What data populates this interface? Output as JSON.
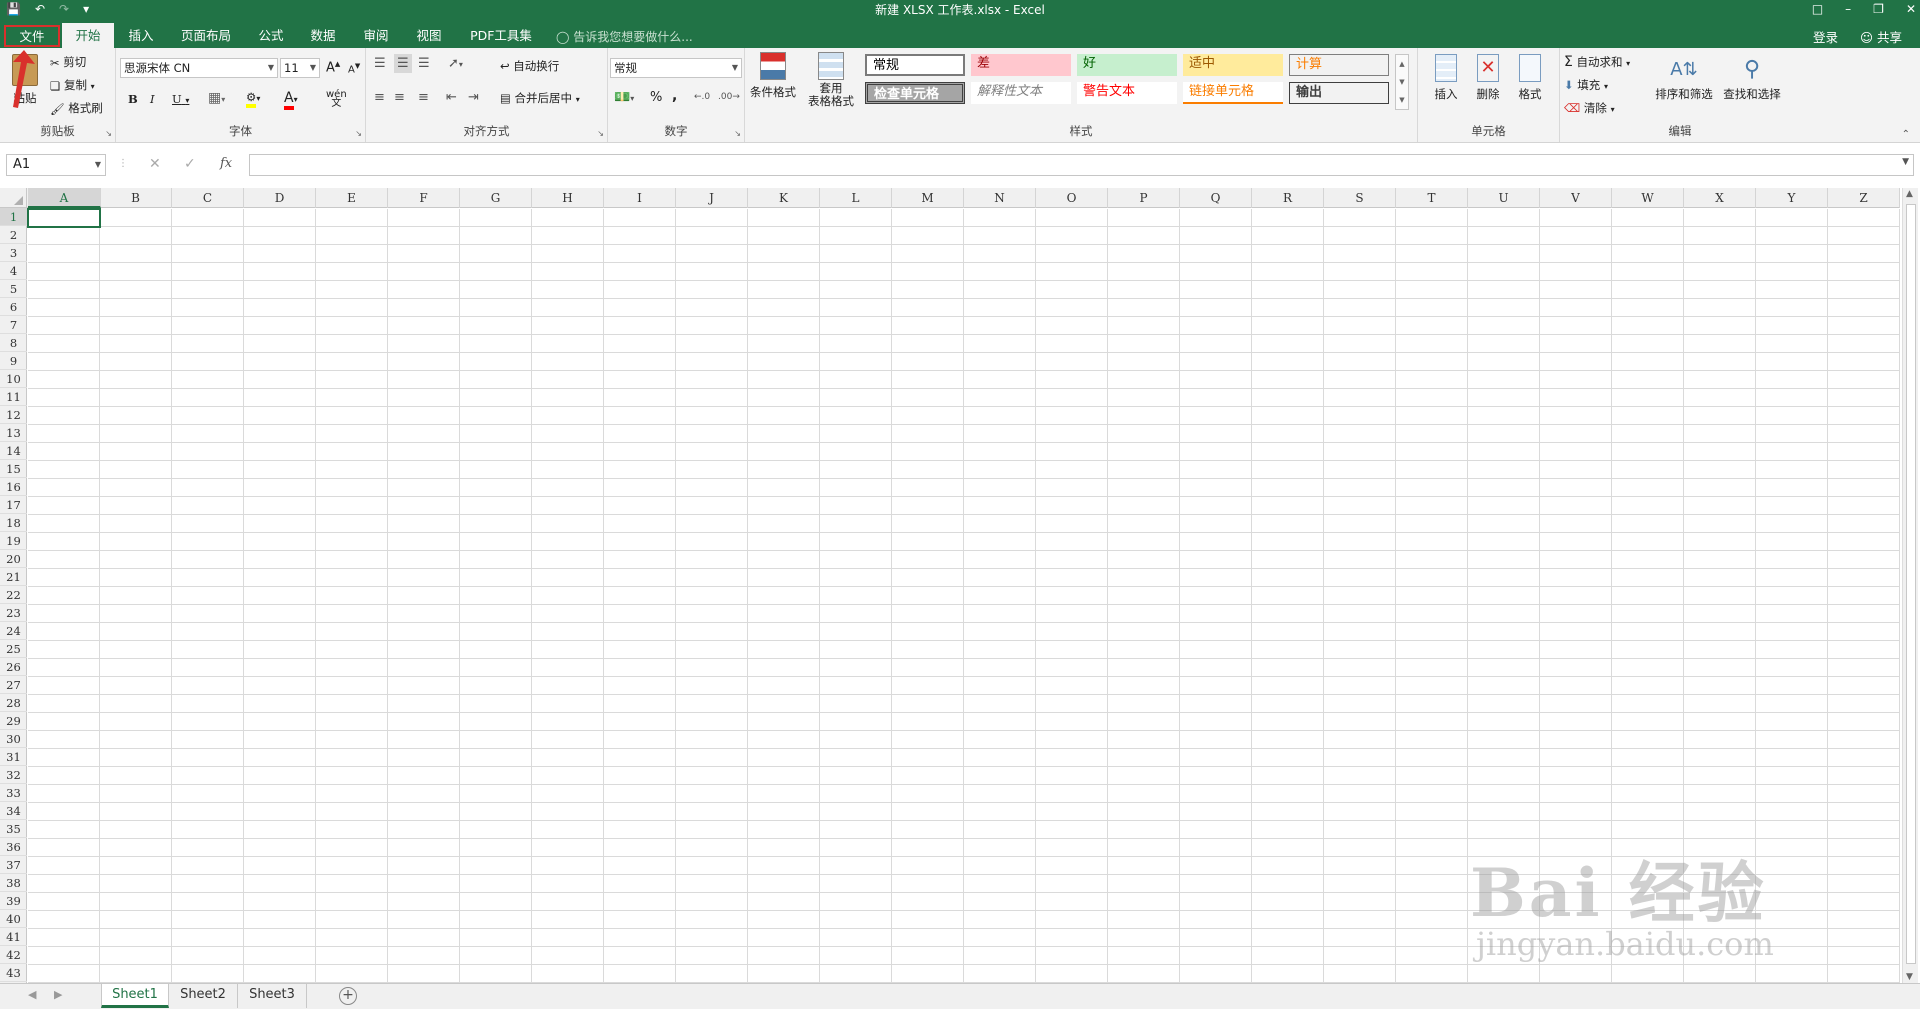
{
  "window": {
    "title": "新建 XLSX 工作表.xlsx - Excel"
  },
  "tabs": [
    {
      "id": "file",
      "label": "文件"
    },
    {
      "id": "home",
      "label": "开始"
    },
    {
      "id": "insert",
      "label": "插入"
    },
    {
      "id": "layout",
      "label": "页面布局"
    },
    {
      "id": "formulas",
      "label": "公式"
    },
    {
      "id": "data",
      "label": "数据"
    },
    {
      "id": "review",
      "label": "审阅"
    },
    {
      "id": "view",
      "label": "视图"
    },
    {
      "id": "pdf",
      "label": "PDF工具集"
    }
  ],
  "tell_me": "告诉我您想要做什么...",
  "account": {
    "login": "登录",
    "share": "共享"
  },
  "ribbon": {
    "clipboard": {
      "label": "剪贴板",
      "paste": "粘贴",
      "cut": "剪切",
      "copy": "复制",
      "format_painter": "格式刷"
    },
    "font": {
      "label": "字体",
      "name": "思源宋体 CN",
      "size": "11",
      "bold": "B",
      "italic": "I",
      "underline": "U",
      "grow": "A",
      "shrink": "A",
      "phonetic": "wén"
    },
    "alignment": {
      "label": "对齐方式",
      "wrap": "自动换行",
      "merge": "合并后居中"
    },
    "number": {
      "label": "数字",
      "format": "常规",
      "percent": "%",
      "comma": ","
    },
    "styles": {
      "label": "样式",
      "conditional": "条件格式",
      "table_format_1": "套用",
      "table_format_2": "表格格式",
      "cells": [
        {
          "text": "常规",
          "bg": "#ffffff",
          "fg": "#000000"
        },
        {
          "text": "差",
          "bg": "#ffc7ce",
          "fg": "#9c0006"
        },
        {
          "text": "好",
          "bg": "#c6efce",
          "fg": "#006100"
        },
        {
          "text": "适中",
          "bg": "#ffeb9c",
          "fg": "#9c5700"
        },
        {
          "text": "计算",
          "bg": "#f2f2f2",
          "fg": "#fa7d00"
        },
        {
          "text": "检查单元格",
          "bg": "#a5a5a5",
          "fg": "#ffffff"
        },
        {
          "text": "解释性文本",
          "bg": "#ffffff",
          "fg": "#7f7f7f"
        },
        {
          "text": "警告文本",
          "bg": "#ffffff",
          "fg": "#ff0000"
        },
        {
          "text": "链接单元格",
          "bg": "#ffffff",
          "fg": "#fa7d00"
        },
        {
          "text": "输出",
          "bg": "#f2f2f2",
          "fg": "#3f3f3f"
        }
      ]
    },
    "cells_group": {
      "label": "单元格",
      "insert": "插入",
      "delete": "删除",
      "format": "格式"
    },
    "editing": {
      "label": "编辑",
      "autosum": "自动求和",
      "fill": "填充",
      "clear": "清除",
      "sort": "排序和筛选",
      "find": "查找和选择"
    }
  },
  "formula_bar": {
    "name_box": "A1",
    "fx": "fx",
    "value": ""
  },
  "grid": {
    "columns": [
      "A",
      "B",
      "C",
      "D",
      "E",
      "F",
      "G",
      "H",
      "I",
      "J",
      "K",
      "L",
      "M",
      "N",
      "O",
      "P",
      "Q",
      "R",
      "S",
      "T",
      "U",
      "V",
      "W",
      "X",
      "Y",
      "Z"
    ],
    "rows": [
      "1",
      "2",
      "3",
      "4",
      "5",
      "6",
      "7",
      "8",
      "9",
      "10",
      "11",
      "12",
      "13",
      "14",
      "15",
      "16",
      "17",
      "18",
      "19",
      "20",
      "21",
      "22",
      "23",
      "24",
      "25",
      "26",
      "27",
      "28",
      "29",
      "30",
      "31",
      "32",
      "33",
      "34",
      "35",
      "36",
      "37",
      "38",
      "39",
      "40",
      "41",
      "42",
      "43"
    ],
    "active_cell": "A1"
  },
  "sheets": [
    {
      "name": "Sheet1",
      "active": true
    },
    {
      "name": "Sheet2",
      "active": false
    },
    {
      "name": "Sheet3",
      "active": false
    }
  ],
  "watermark": {
    "main": "Bai 经验",
    "sub": "jingyan.baidu.com"
  }
}
